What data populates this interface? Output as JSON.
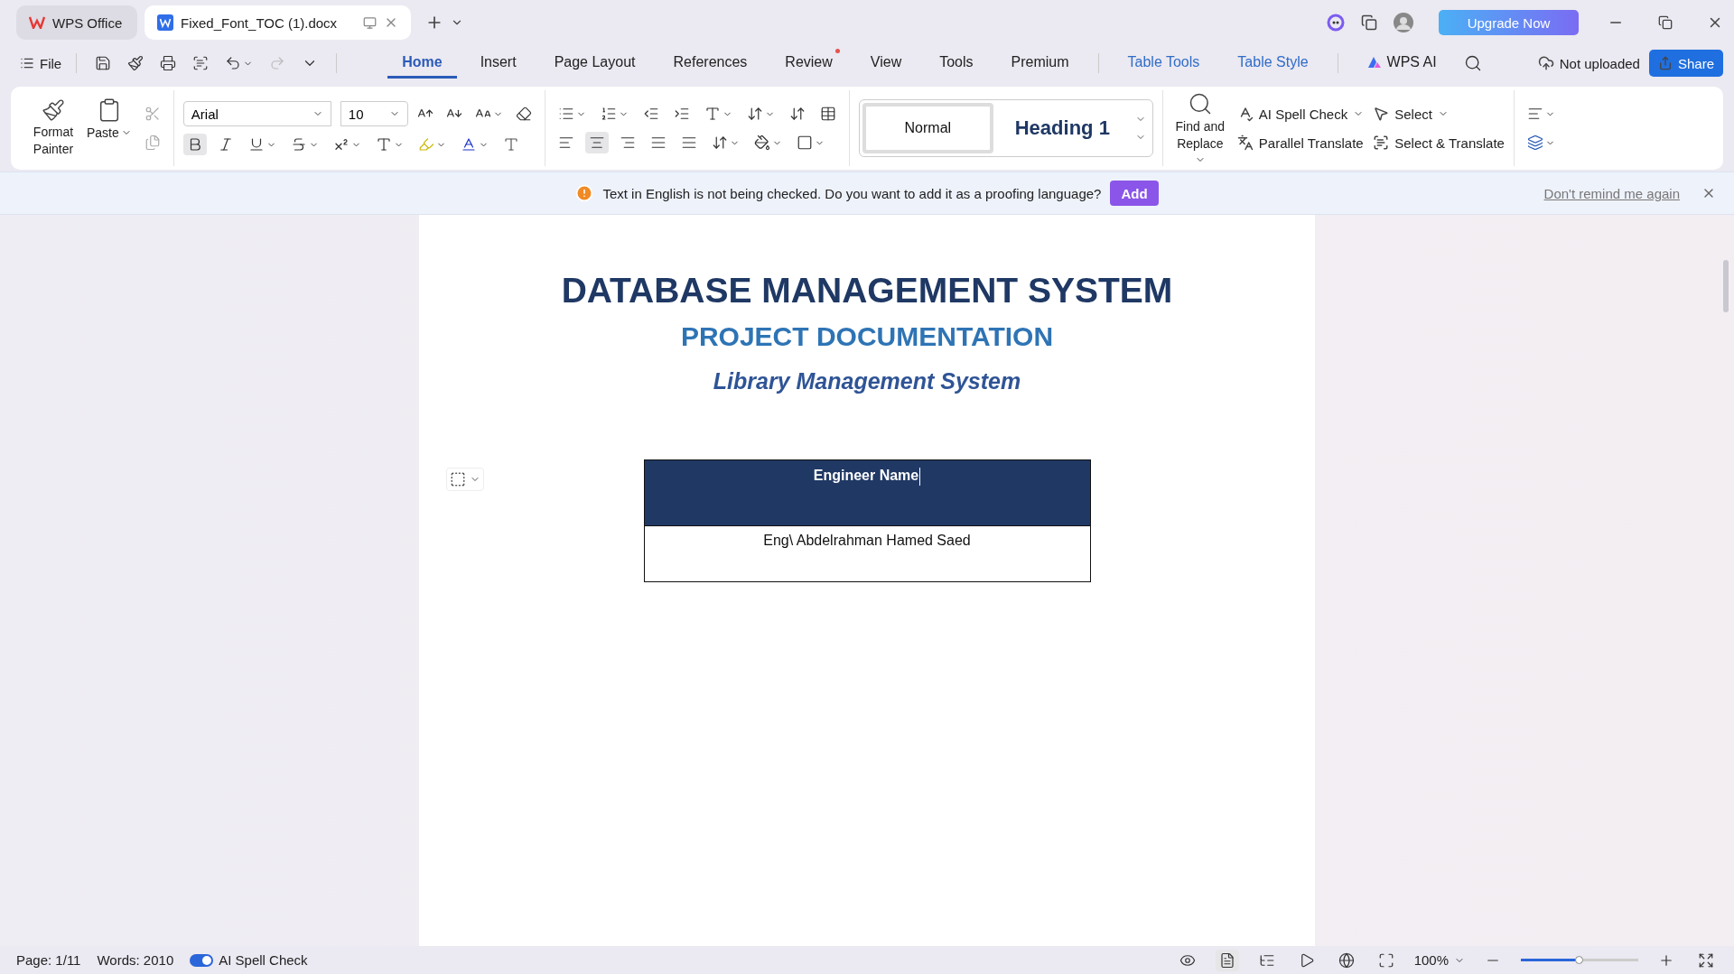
{
  "window_tabs": [
    {
      "label": "WPS Office",
      "kind": "home",
      "selected": false
    },
    {
      "label": "Fixed_Font_TOC (1).docx",
      "kind": "doc",
      "selected": true
    }
  ],
  "upgrade_button": "Upgrade Now",
  "menu": {
    "file": "File",
    "tabs": [
      {
        "label": "Home",
        "selected": true,
        "kind": "plain",
        "dot": false
      },
      {
        "label": "Insert",
        "selected": false,
        "kind": "plain",
        "dot": false
      },
      {
        "label": "Page Layout",
        "selected": false,
        "kind": "plain",
        "dot": false
      },
      {
        "label": "References",
        "selected": false,
        "kind": "plain",
        "dot": false
      },
      {
        "label": "Review",
        "selected": false,
        "kind": "plain",
        "dot": true
      },
      {
        "label": "View",
        "selected": false,
        "kind": "plain",
        "dot": false
      },
      {
        "label": "Tools",
        "selected": false,
        "kind": "plain",
        "dot": false
      },
      {
        "label": "Premium",
        "selected": false,
        "kind": "plain",
        "dot": false
      },
      {
        "label": "Table Tools",
        "selected": false,
        "kind": "context",
        "dot": false
      },
      {
        "label": "Table Style",
        "selected": false,
        "kind": "context",
        "dot": false
      },
      {
        "label": "WPS AI",
        "selected": false,
        "kind": "ai",
        "dot": false
      }
    ],
    "not_uploaded": "Not uploaded",
    "share": "Share"
  },
  "ribbon": {
    "format_painter": "Format Painter",
    "paste": "Paste",
    "font": "Arial",
    "size": "10",
    "bold": true,
    "align_center": true,
    "styles": [
      {
        "label": "Normal",
        "selected": true
      },
      {
        "label": "Heading 1",
        "selected": false
      }
    ],
    "find_replace": "Find and Replace",
    "ai_spell_check": "AI Spell Check",
    "parallel_translate": "Parallel Translate",
    "select": "Select",
    "select_translate": "Select & Translate"
  },
  "notice": {
    "message": "Text in English is not being checked. Do you want to add it as a proofing language?",
    "add": "Add",
    "dismiss": "Don't remind me again"
  },
  "document": {
    "title": "DATABASE MANAGEMENT SYSTEM",
    "subtitle": "PROJECT DOCUMENTATION",
    "system": "Library Management System",
    "table": {
      "header": "Engineer Name",
      "value": "Eng\\ Abdelrahman Hamed Saed"
    }
  },
  "status_bar": {
    "page": "Page: 1/11",
    "words": "Words: 2010",
    "spell_check": {
      "label": "AI Spell Check",
      "on": true
    },
    "zoom": "100%",
    "zoom_slider": {
      "level": 0.5
    }
  }
}
